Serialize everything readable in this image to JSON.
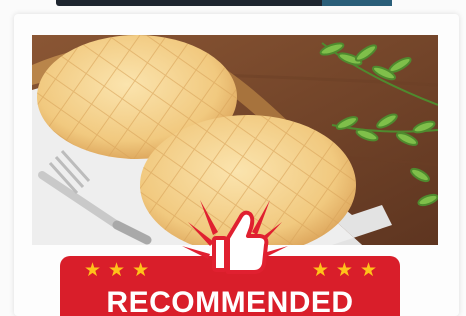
{
  "badge": {
    "label": "RECOMMENDED",
    "stars_left": "★★★",
    "stars_right": "★★★",
    "badge_color": "#d91e2a",
    "star_color": "#ffc21a",
    "rating_stars_each_side": 3
  },
  "icons": {
    "thumb": "thumbs-up-icon",
    "burst": "burst-lines-icon",
    "star": "star-icon"
  },
  "photo": {
    "subject_icon": "melon-pan-bread",
    "colors": {
      "table": "#7a4a2d",
      "bread": "#f3cf8a",
      "leaf": "#7fbf4a"
    }
  }
}
